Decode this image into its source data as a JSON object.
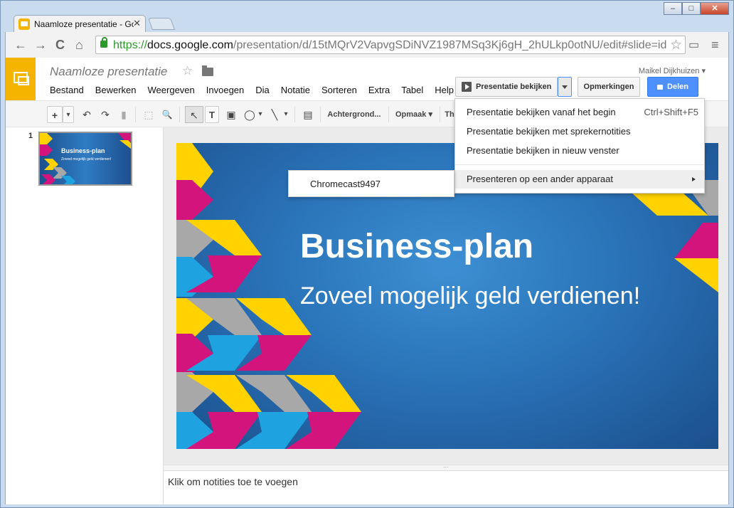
{
  "browser": {
    "tab_title": "Naamloze presentatie - Go",
    "tab_close": "✕",
    "url_scheme": "https://",
    "url_host": "docs.google.com",
    "url_path": "/presentation/d/15tMQrV2VapvgSDiNVZ1987MSq3Kj6gH_2hULkp0otNU/edit#slide=id",
    "back_glyph": "←",
    "forward_glyph": "→",
    "reload_glyph": "C",
    "home_glyph": "⌂",
    "bookmark_star": "☆",
    "cast_glyph": "▭",
    "menu_glyph": "≡",
    "window_minimize": "–",
    "window_maximize": "□",
    "window_close": "✕"
  },
  "app": {
    "doc_title": "Naamloze presentatie",
    "title_star": "☆",
    "user_name": "Maikel Dijkhuizen ▾",
    "menu": [
      "Bestand",
      "Bewerken",
      "Weergeven",
      "Invoegen",
      "Dia",
      "Notatie",
      "Sorteren",
      "Extra",
      "Tabel",
      "Help"
    ],
    "present_button": "Presentatie bekijken",
    "comments_button": "Opmerkingen",
    "share_button": "Delen"
  },
  "toolbar": {
    "add": "+",
    "add_drop": "▾",
    "undo": "↶",
    "redo": "↷",
    "paint": "▮",
    "select_frame": "⬚",
    "zoom": "🔍",
    "cursor": "↖",
    "textbox": "T",
    "image": "▣",
    "shape": "◯",
    "shape_drop": "▾",
    "line": "╲",
    "line_drop": "▾",
    "comment": "▤",
    "background_label": "Achtergrond...",
    "format_label": "Opmaak ▾",
    "theme_label": "Th"
  },
  "filmstrip": {
    "slide_number": "1",
    "thumb_title": "Business-plan",
    "thumb_subtitle": "Zoveel mogelijk geld verdienen!"
  },
  "slide": {
    "title": "Business-plan",
    "subtitle": "Zoveel mogelijk geld verdienen!"
  },
  "notes": {
    "handle": "···",
    "placeholder": "Klik om notities toe te voegen"
  },
  "present_menu": {
    "items": [
      {
        "label": "Presentatie bekijken vanaf het begin",
        "shortcut": "Ctrl+Shift+F5"
      },
      {
        "label": "Presentatie bekijken met sprekernotities",
        "shortcut": ""
      },
      {
        "label": "Presentatie bekijken in nieuw venster",
        "shortcut": ""
      },
      {
        "label": "Presenteren op een ander apparaat",
        "shortcut": ""
      }
    ]
  },
  "device_menu": {
    "items": [
      {
        "label": "Chromecast9497"
      }
    ]
  },
  "colors": {
    "accent_yellow": "#f4b400",
    "share_blue": "#4d90fe",
    "slide_blue": "#2a73b8",
    "shape_yellow": "#ffd200",
    "shape_magenta": "#d4147d",
    "shape_cyan": "#1ea3e0",
    "shape_gray": "#a8a8a8"
  }
}
